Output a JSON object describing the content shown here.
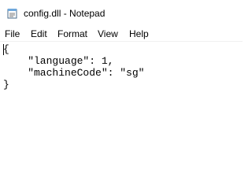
{
  "window": {
    "title": "config.dll - Notepad",
    "icon": "notepad-icon"
  },
  "menu": {
    "file": "File",
    "edit": "Edit",
    "format": "Format",
    "view": "View",
    "help": "Help"
  },
  "editor": {
    "lines": [
      "{",
      "    \"language\": 1,",
      "    \"machineCode\": \"sg\"",
      "}"
    ]
  },
  "colors": {
    "background": "#ffffff",
    "text": "#000000"
  }
}
